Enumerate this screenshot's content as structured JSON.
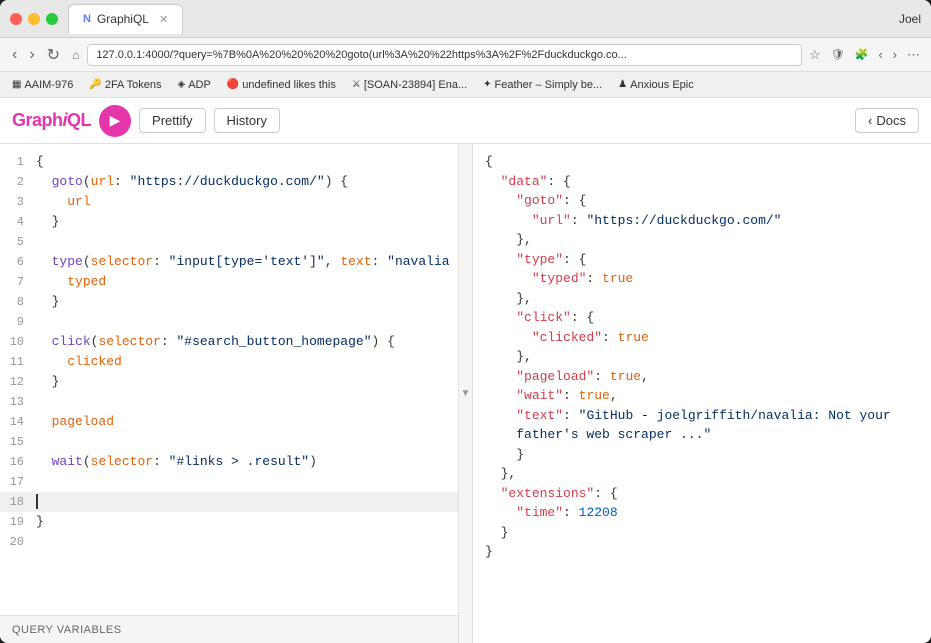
{
  "window": {
    "title": "GraphiQL",
    "user": "Joel"
  },
  "tab": {
    "label": "GraphiQL",
    "icon": "N",
    "url": "127.0.0.1:4000/?query=%7B%0A%20%20%20%20goto(url%3A%20%22https%3A%2F%2Fduckduckgo.co..."
  },
  "nav": {
    "back": "‹",
    "forward": "›",
    "refresh": "↻"
  },
  "bookmarks": [
    {
      "icon": "▦",
      "label": "AAIM-976"
    },
    {
      "icon": "🔑",
      "label": "2FA Tokens"
    },
    {
      "icon": "◈",
      "label": "ADP"
    },
    {
      "icon": "🔴",
      "label": "undefined likes this"
    },
    {
      "icon": "⚔",
      "label": "[SOAN-23894] Ena..."
    },
    {
      "icon": "✦",
      "label": "Feather – Simply be..."
    },
    {
      "icon": "♟",
      "label": "Anxious Epic"
    }
  ],
  "graphiql": {
    "title": "GraphiQL",
    "run_label": "▶",
    "prettify_label": "Prettify",
    "history_label": "History",
    "docs_label": "Docs"
  },
  "editor": {
    "lines": [
      {
        "num": "1",
        "content": "{",
        "type": "plain"
      },
      {
        "num": "2",
        "content": "  goto(url: \"https://duckduckgo.com/\") {",
        "type": "goto"
      },
      {
        "num": "3",
        "content": "    url",
        "type": "plain"
      },
      {
        "num": "4",
        "content": "  }",
        "type": "plain"
      },
      {
        "num": "5",
        "content": "",
        "type": "plain"
      },
      {
        "num": "6",
        "content": "  type(selector: \"input[type='text']\", text: \"navalia github\") {",
        "type": "type"
      },
      {
        "num": "7",
        "content": "    typed",
        "type": "plain"
      },
      {
        "num": "8",
        "content": "  }",
        "type": "plain"
      },
      {
        "num": "9",
        "content": "",
        "type": "plain"
      },
      {
        "num": "10",
        "content": "  click(selector: \"#search_button_homepage\") {",
        "type": "click"
      },
      {
        "num": "11",
        "content": "    clicked",
        "type": "plain"
      },
      {
        "num": "12",
        "content": "  }",
        "type": "plain"
      },
      {
        "num": "13",
        "content": "",
        "type": "plain"
      },
      {
        "num": "14",
        "content": "  pageload",
        "type": "plain"
      },
      {
        "num": "15",
        "content": "",
        "type": "plain"
      },
      {
        "num": "16",
        "content": "  wait(selector: \"#links > .result\")",
        "type": "wait"
      },
      {
        "num": "17",
        "content": "",
        "type": "plain"
      },
      {
        "num": "18",
        "content": "",
        "type": "cursor"
      },
      {
        "num": "19",
        "content": "}",
        "type": "plain"
      },
      {
        "num": "20",
        "content": "",
        "type": "plain"
      }
    ]
  },
  "result": {
    "lines": [
      {
        "indent": 0,
        "content": "{"
      },
      {
        "indent": 1,
        "content": "\"data\": {"
      },
      {
        "indent": 2,
        "content": "\"goto\": {"
      },
      {
        "indent": 3,
        "content": "\"url\": \"https://duckduckgo.com/\""
      },
      {
        "indent": 2,
        "content": "},"
      },
      {
        "indent": 2,
        "content": "\"type\": {"
      },
      {
        "indent": 3,
        "content": "\"typed\": true"
      },
      {
        "indent": 2,
        "content": "},"
      },
      {
        "indent": 2,
        "content": "\"click\": {"
      },
      {
        "indent": 3,
        "content": "\"clicked\": true"
      },
      {
        "indent": 2,
        "content": "},"
      },
      {
        "indent": 2,
        "content": "\"pageload\": true,"
      },
      {
        "indent": 2,
        "content": "\"wait\": true,"
      },
      {
        "indent": 2,
        "content": "\"text\": \"GitHub - joelgriffith/navalia: Not your father's web scraper ...\""
      },
      {
        "indent": 1,
        "content": "},"
      },
      {
        "indent": 1,
        "content": "\"extensions\": {"
      },
      {
        "indent": 2,
        "content": "\"time\": 12208"
      },
      {
        "indent": 1,
        "content": "}"
      },
      {
        "indent": 0,
        "content": "}"
      }
    ]
  },
  "query_vars": {
    "label": "QUERY VARIABLES"
  }
}
